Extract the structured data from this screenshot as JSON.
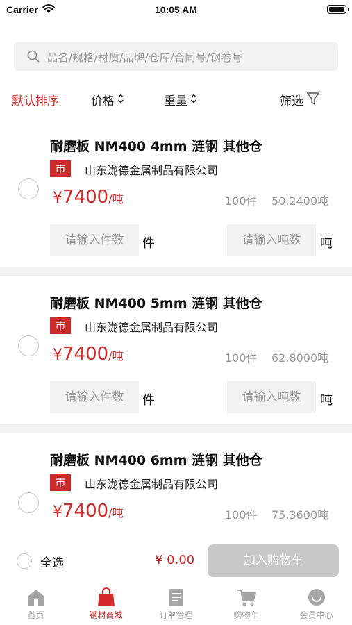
{
  "status_bar": {
    "carrier": "Carrier",
    "time": "10:05 AM"
  },
  "search": {
    "placeholder": "品名/规格/材质/品牌/仓库/合同号/钢卷号"
  },
  "sort": {
    "default": "默认排序",
    "price": "价格",
    "weight": "重量",
    "filter": "筛选"
  },
  "products": [
    {
      "title": "耐磨板 NM400 4mm 涟钢 其他仓",
      "badge": "市",
      "company": "山东泷德金属制品有限公司",
      "currency": "¥",
      "price": "7400",
      "price_unit": "/吨",
      "pieces": "100件",
      "tons": "50.2400吨",
      "qty_pieces_placeholder": "请输入件数",
      "qty_pieces_unit": "件",
      "qty_tons_placeholder": "请输入吨数",
      "qty_tons_unit": "吨"
    },
    {
      "title": "耐磨板 NM400 5mm 涟钢 其他仓",
      "badge": "市",
      "company": "山东泷德金属制品有限公司",
      "currency": "¥",
      "price": "7400",
      "price_unit": "/吨",
      "pieces": "100件",
      "tons": "62.8000吨",
      "qty_pieces_placeholder": "请输入件数",
      "qty_pieces_unit": "件",
      "qty_tons_placeholder": "请输入吨数",
      "qty_tons_unit": "吨"
    },
    {
      "title": "耐磨板 NM400 6mm 涟钢 其他仓",
      "badge": "市",
      "company": "山东泷德金属制品有限公司",
      "currency": "¥",
      "price": "7400",
      "price_unit": "/吨",
      "pieces": "100件",
      "tons": "75.3600吨"
    }
  ],
  "cart_bar": {
    "select_all": "全选",
    "total": "¥ 0.00",
    "add_to_cart": "加入购物车"
  },
  "tabs": [
    {
      "label": "首页",
      "icon": "home-icon",
      "active": false
    },
    {
      "label": "钢材商城",
      "icon": "shopping-bag-icon",
      "active": true
    },
    {
      "label": "订单管理",
      "icon": "order-icon",
      "active": false
    },
    {
      "label": "购物车",
      "icon": "cart-icon",
      "active": false
    },
    {
      "label": "会员中心",
      "icon": "member-icon",
      "active": false
    }
  ],
  "colors": {
    "accent": "#d42a2a",
    "badge": "#c92b2b",
    "inactive": "#a6a6a6",
    "button_disabled": "#c8c8c8",
    "background_gray": "#f2f2f2"
  }
}
